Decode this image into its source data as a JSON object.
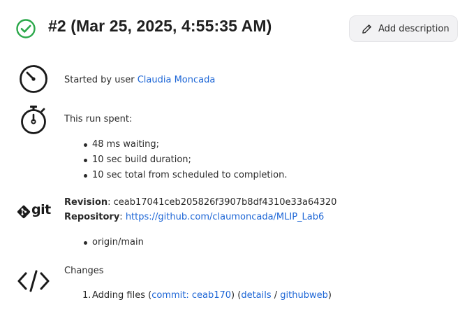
{
  "build": {
    "title": "#2 (Mar 25, 2025, 4:55:35 AM)",
    "status_color": "#2ba84a",
    "add_description_label": "Add description"
  },
  "started": {
    "prefix": "Started by user",
    "user": "Claudia Moncada"
  },
  "timing": {
    "heading": "This run spent:",
    "items": [
      "48 ms waiting;",
      "10 sec build duration;",
      "10 sec total from scheduled to completion."
    ]
  },
  "git": {
    "logo_text": "git",
    "revision_label": "Revision",
    "revision_value": "ceab17041ceb205826f3907b8df4310e33a64320",
    "repository_label": "Repository",
    "repository_url": "https://github.com/claumoncada/MLIP_Lab6",
    "branches": [
      "origin/main"
    ]
  },
  "changes": {
    "heading": "Changes",
    "items": [
      {
        "number": "1.",
        "message": "Adding files",
        "commit_label": "commit",
        "commit_id": "ceab170",
        "details_label": "details",
        "web_label": "githubweb"
      }
    ]
  },
  "colors": {
    "link": "#1d66d6",
    "text": "#2a2a2a"
  }
}
